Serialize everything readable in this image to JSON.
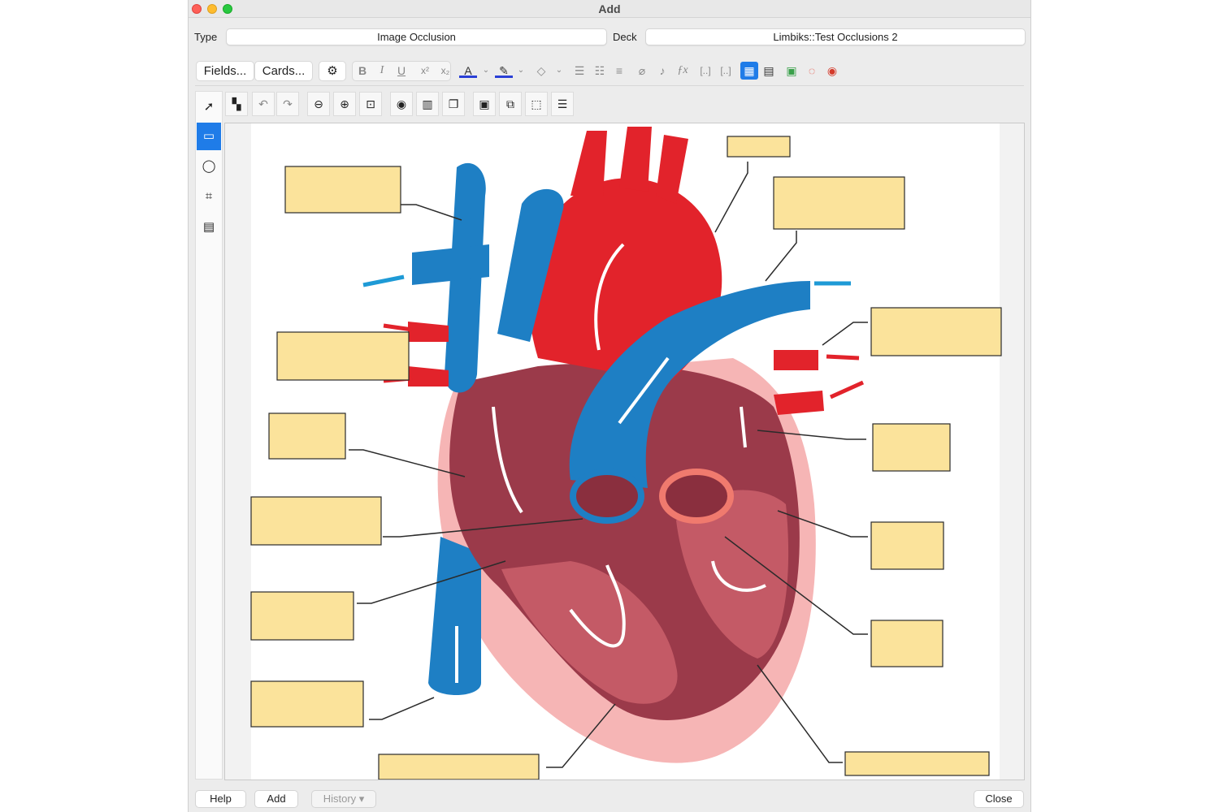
{
  "window": {
    "title": "Add"
  },
  "note_type": {
    "label": "Type",
    "value": "Image Occlusion"
  },
  "deck": {
    "label": "Deck",
    "value": "Limbiks::Test Occlusions 2"
  },
  "toolbar": {
    "fields_label": "Fields...",
    "cards_label": "Cards...",
    "icons": [
      "gear-icon",
      "bold-icon",
      "italic-icon",
      "underline-icon",
      "superscript-icon",
      "subscript-icon",
      "text-color-icon",
      "highlight-icon",
      "eraser-icon",
      "bullet-list-icon",
      "numbered-list-icon",
      "align-icon",
      "attachment-icon",
      "microphone-icon",
      "formula-icon",
      "cloze-icon",
      "cloze-same-icon",
      "image-occlusion-icon",
      "table-icon",
      "image-icon",
      "record-icon",
      "settings-icon"
    ],
    "bold": "B",
    "italic": "I",
    "underline": "U",
    "sup": "x²",
    "sub": "x₂",
    "text_color": "A",
    "formula": "ƒx"
  },
  "occlusion_toolbar": {
    "icons": [
      "mask-toggle-icon",
      "undo-icon",
      "redo-icon",
      "zoom-out-icon",
      "zoom-in-icon",
      "zoom-fit-icon",
      "eye-icon",
      "delete-icon",
      "duplicate-icon",
      "group-icon",
      "ungroup-icon",
      "select-all-icon",
      "align-icon"
    ]
  },
  "side_tools": {
    "icons": [
      "select-arrow-icon",
      "rectangle-tool-icon",
      "ellipse-tool-icon",
      "polygon-tool-icon",
      "text-tool-icon"
    ],
    "active": "rectangle-tool-icon"
  },
  "colors": {
    "accent": "#1f7ce8",
    "mask_fill": "#fbe39b",
    "mask_border": "#2b2b2b",
    "vein_blue": "#1e7fc4",
    "artery_red": "#e2232b"
  },
  "bottom": {
    "help_label": "Help",
    "add_label": "Add",
    "history_label": "History ▾",
    "close_label": "Close"
  }
}
